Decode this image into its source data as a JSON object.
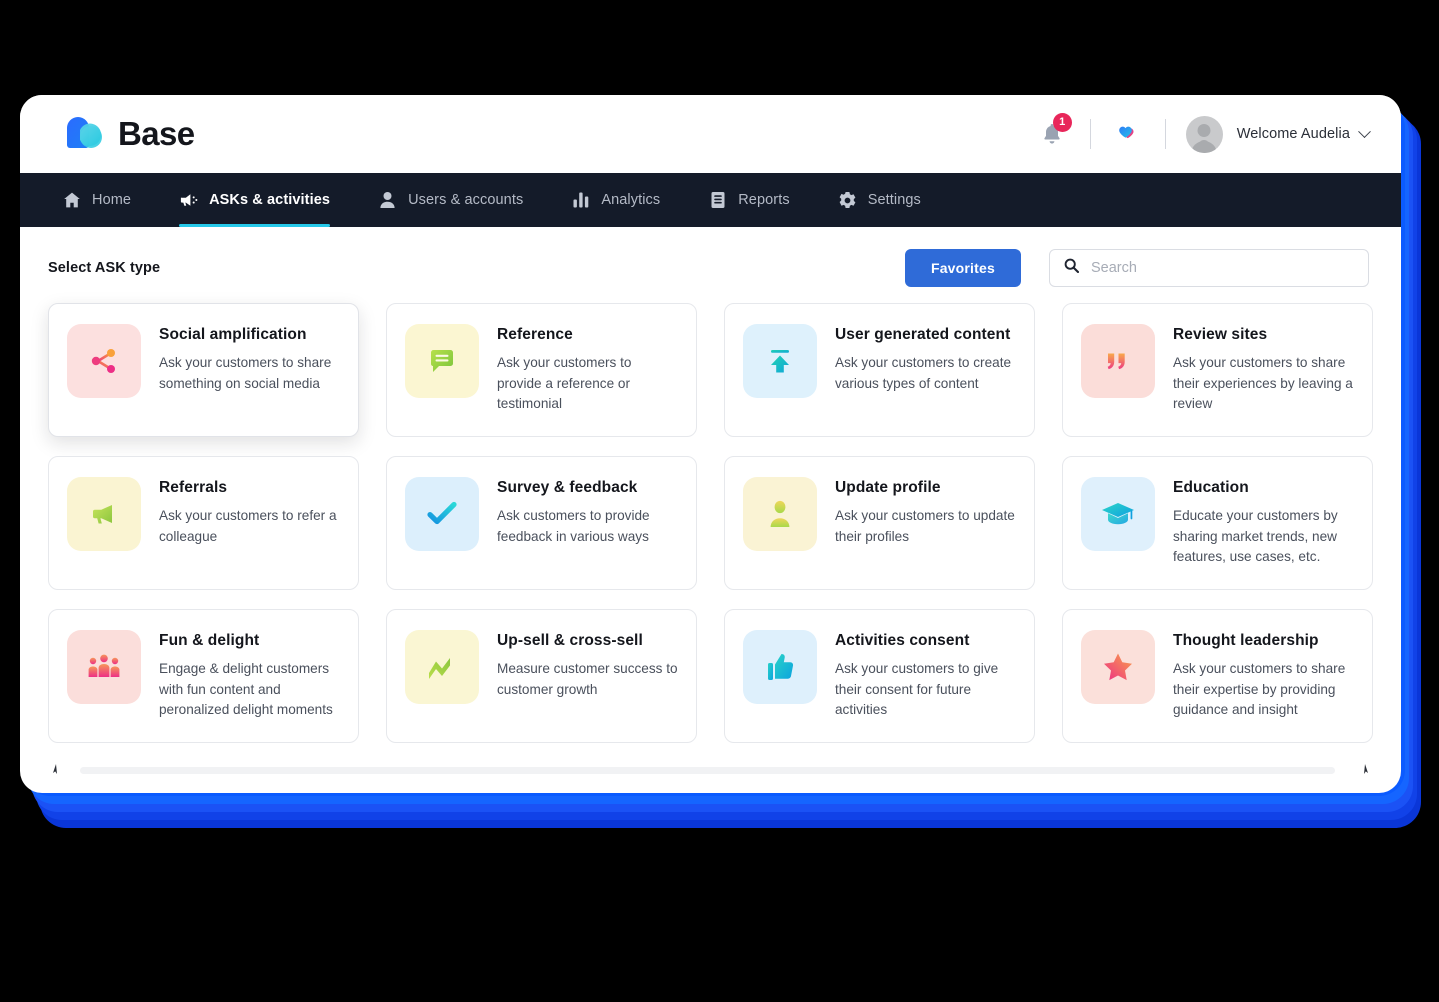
{
  "brand": {
    "name": "Base",
    "logo_icon": "base-logo-icon"
  },
  "header": {
    "notifications": {
      "icon": "bell-icon",
      "count": "1"
    },
    "favorites_heart": {
      "icon": "heart-icon"
    },
    "avatar": {
      "icon": "avatar-placeholder-icon"
    },
    "user_menu_label": "Welcome Audelia",
    "caret_icon": "chevron-down-icon"
  },
  "nav": {
    "items": [
      {
        "label": "Home",
        "icon": "home-icon",
        "active": false
      },
      {
        "label": "ASKs & activities",
        "icon": "megaphone-icon",
        "active": true
      },
      {
        "label": "Users & accounts",
        "icon": "user-icon",
        "active": false
      },
      {
        "label": "Analytics",
        "icon": "bar-chart-icon",
        "active": false
      },
      {
        "label": "Reports",
        "icon": "document-icon",
        "active": false
      },
      {
        "label": "Settings",
        "icon": "gear-icon",
        "active": false
      }
    ]
  },
  "toolbar": {
    "section_title": "Select ASK type",
    "favorites_label": "Favorites",
    "search": {
      "placeholder": "Search",
      "value": "",
      "icon": "search-icon"
    }
  },
  "colors": {
    "accent_blue": "#2F6BD8",
    "nav_bg": "#141B29",
    "nav_active_underline": "#25C8E8",
    "badge_red": "#E8265A",
    "page_bg": "#000000",
    "window_bg": "#FFFFFF",
    "shadow_blue": "#0B5BFF"
  },
  "cards": [
    {
      "title": "Social amplification",
      "desc": "Ask your customers to share something on social media",
      "icon": "share-icon",
      "tile_bg": "#FCE0DF",
      "hovered": true
    },
    {
      "title": "Reference",
      "desc": "Ask your customers to provide a reference or testimonial",
      "icon": "speech-bubble-icon",
      "tile_bg": "#FBF6D2",
      "hovered": false
    },
    {
      "title": "User generated content",
      "desc": "Ask your customers to create various types of content",
      "icon": "upload-arrow-icon",
      "tile_bg": "#DEF1FC",
      "hovered": false
    },
    {
      "title": "Review sites",
      "desc": "Ask your customers to share their experiences by leaving a review",
      "icon": "quote-marks-icon",
      "tile_bg": "#FBDDD9",
      "hovered": false
    },
    {
      "title": "Referrals",
      "desc": "Ask your customers to refer a colleague",
      "icon": "megaphone-icon",
      "tile_bg": "#FAF4D2",
      "hovered": false
    },
    {
      "title": "Survey & feedback",
      "desc": "Ask customers to provide feedback in various ways",
      "icon": "check-mark-icon",
      "tile_bg": "#DCEFFC",
      "hovered": false
    },
    {
      "title": "Update profile",
      "desc": "Ask your customers to update their profiles",
      "icon": "person-icon",
      "tile_bg": "#FAF3D4",
      "hovered": false
    },
    {
      "title": "Education",
      "desc": "Educate your customers by sharing market trends, new features, use cases, etc.",
      "icon": "graduation-cap-icon",
      "tile_bg": "#DFF0FC",
      "hovered": false
    },
    {
      "title": "Fun & delight",
      "desc": "Engage & delight customers with fun content and peronalized delight moments",
      "icon": "people-group-icon",
      "tile_bg": "#FBDEDB",
      "hovered": false
    },
    {
      "title": "Up-sell & cross-sell",
      "desc": "Measure customer success to customer growth",
      "icon": "trend-zigzag-icon",
      "tile_bg": "#FAF6D3",
      "hovered": false
    },
    {
      "title": "Activities consent",
      "desc": "Ask your customers to give their consent for future activities",
      "icon": "thumbs-up-icon",
      "tile_bg": "#DEF0FC",
      "hovered": false
    },
    {
      "title": "Thought leadership",
      "desc": "Ask your customers to share their expertise by providing guidance and insight",
      "icon": "star-icon",
      "tile_bg": "#FBE0DA",
      "hovered": false
    }
  ]
}
